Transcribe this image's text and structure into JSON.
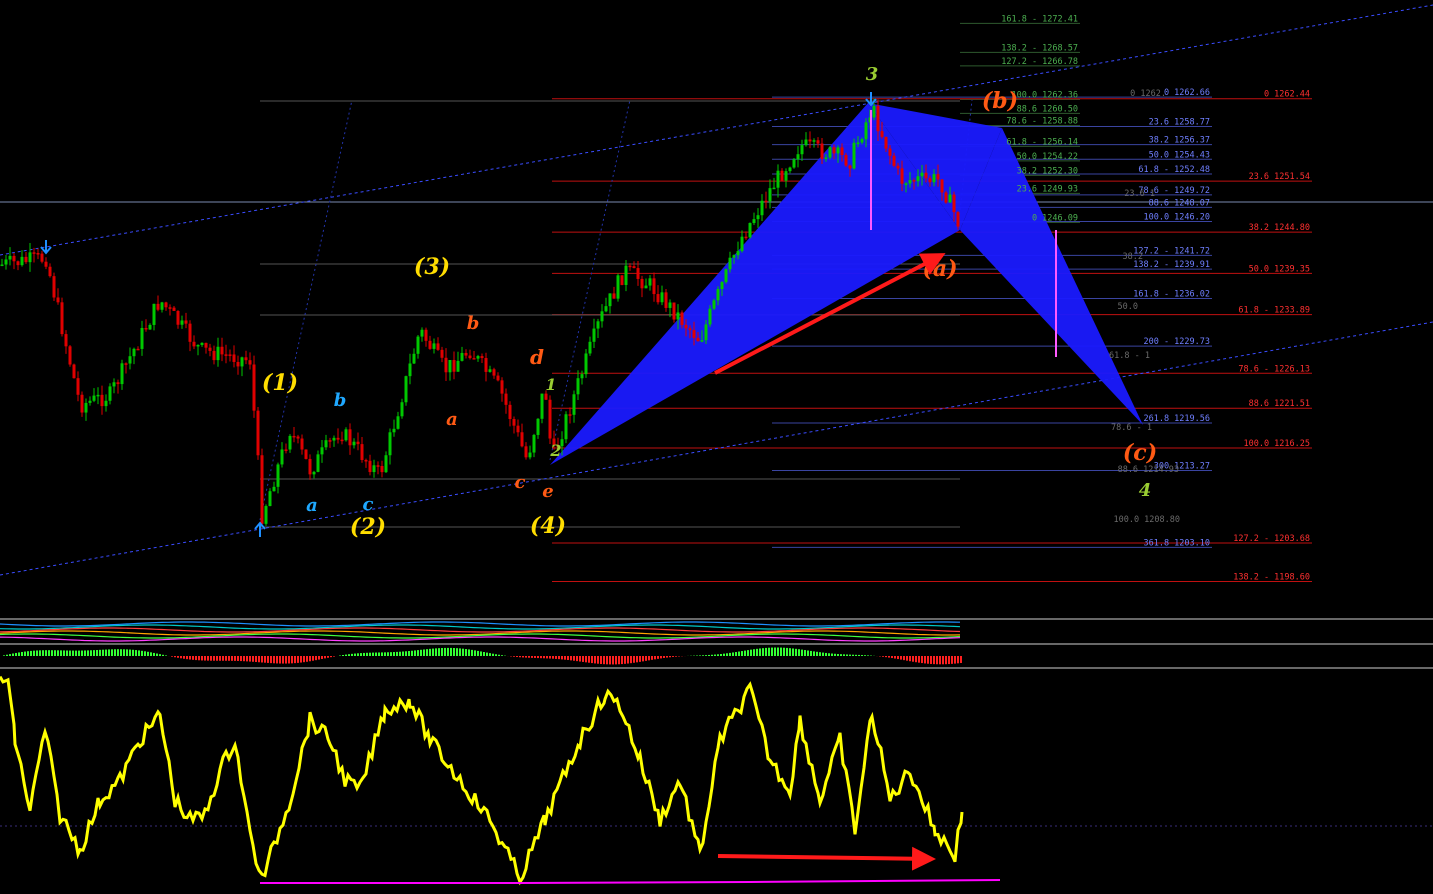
{
  "chart_data": [
    {
      "type": "candlestick",
      "title": "",
      "ylim": [
        1193.5,
        1275.5
      ],
      "grid": false,
      "fib_levels": [
        {
          "text": "161.8 - 1272.41",
          "price": 1272.41,
          "set": "green"
        },
        {
          "text": "138.2 - 1268.57",
          "price": 1268.57,
          "set": "green"
        },
        {
          "text": "127.2 - 1266.78",
          "price": 1266.78,
          "set": "green"
        },
        {
          "text": "100.0 1262.36",
          "price": 1262.36,
          "set": "green"
        },
        {
          "text": "88.6 1260.50",
          "price": 1260.5,
          "set": "green"
        },
        {
          "text": "78.6 - 1258.88",
          "price": 1258.88,
          "set": "green"
        },
        {
          "text": "61.8 - 1256.14",
          "price": 1256.14,
          "set": "green"
        },
        {
          "text": "50.0 1254.22",
          "price": 1254.22,
          "set": "green"
        },
        {
          "text": "38.2 1252.30",
          "price": 1252.3,
          "set": "green"
        },
        {
          "text": "23.6 1249.93",
          "price": 1249.93,
          "set": "green"
        },
        {
          "text": "0 1246.09",
          "price": 1246.09,
          "set": "green"
        },
        {
          "text": "0 1262.66",
          "price": 1262.66,
          "set": "blue"
        },
        {
          "text": "23.6 1258.77",
          "price": 1258.77,
          "set": "blue"
        },
        {
          "text": "38.2 1256.37",
          "price": 1256.37,
          "set": "blue"
        },
        {
          "text": "50.0 1254.43",
          "price": 1254.43,
          "set": "blue"
        },
        {
          "text": "61.8 - 1252.48",
          "price": 1252.48,
          "set": "blue"
        },
        {
          "text": "78.6 - 1249.72",
          "price": 1249.72,
          "set": "blue"
        },
        {
          "text": "88.6 1248.07",
          "price": 1248.07,
          "set": "blue"
        },
        {
          "text": "100.0 1246.20",
          "price": 1246.2,
          "set": "blue"
        },
        {
          "text": "127.2 - 1241.72",
          "price": 1241.72,
          "set": "blue"
        },
        {
          "text": "138.2 - 1239.91",
          "price": 1239.91,
          "set": "blue"
        },
        {
          "text": "161.8 - 1236.02",
          "price": 1236.02,
          "set": "blue"
        },
        {
          "text": "200 - 1229.73",
          "price": 1229.73,
          "set": "blue"
        },
        {
          "text": "261.8 1219.56",
          "price": 1219.56,
          "set": "blue"
        },
        {
          "text": "300 1213.27",
          "price": 1213.27,
          "set": "blue"
        },
        {
          "text": "361.8 1203.10",
          "price": 1203.1,
          "set": "blue"
        },
        {
          "text": "0 1262.44",
          "price": 1262.44,
          "set": "red"
        },
        {
          "text": "23.6 1251.54",
          "price": 1251.54,
          "set": "red"
        },
        {
          "text": "38.2 1244.80",
          "price": 1244.8,
          "set": "red"
        },
        {
          "text": "50.0 1239.35",
          "price": 1239.35,
          "set": "red"
        },
        {
          "text": "61.8 - 1233.89",
          "price": 1233.89,
          "set": "red"
        },
        {
          "text": "78.6 - 1226.13",
          "price": 1226.13,
          "set": "red"
        },
        {
          "text": "88.6 1221.51",
          "price": 1221.51,
          "set": "red"
        },
        {
          "text": "100.0 1216.25",
          "price": 1216.25,
          "set": "red"
        },
        {
          "text": "127.2 - 1203.68",
          "price": 1203.68,
          "set": "red"
        },
        {
          "text": "138.2 - 1198.60",
          "price": 1198.6,
          "set": "red"
        }
      ],
      "gray_labels": [
        "0 1262.",
        "23.6 1",
        "38.2",
        "50.0",
        "61.8 - 1",
        "78.6 - 1",
        "88.6 1214.93",
        "100.0 1208.80"
      ],
      "wave_labels": [
        "(1)",
        "(2)",
        "(3)",
        "(4)",
        "(a)",
        "(b)",
        "(c)",
        "3",
        "4",
        "1",
        "2",
        "a",
        "b",
        "c",
        "a",
        "b",
        "c",
        "d",
        "e"
      ],
      "colors": {
        "up": "#00c800",
        "down": "#e00000",
        "pattern": "#1a1aff",
        "arrow": "#ff1a1a",
        "label_yellow": "#ffdd00",
        "label_orange": "#ff5a14",
        "label_cyan": "#1fa8ff",
        "label_green": "#9acd32"
      }
    },
    {
      "type": "line",
      "title": "",
      "colors": {
        "line": "#ffff00",
        "trendline": "#ff00ff",
        "arrow": "#ff1a1a"
      }
    }
  ]
}
